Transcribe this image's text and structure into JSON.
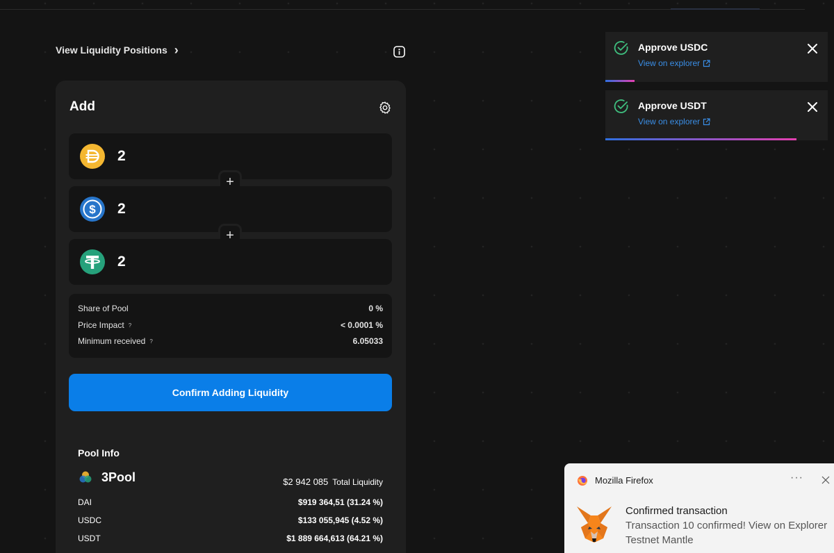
{
  "nav": {
    "positions_link": "View Liquidity Positions",
    "chevron": "›"
  },
  "card": {
    "title": "Add",
    "tokens": [
      {
        "symbol_icon": "dai-icon",
        "value": "2",
        "color": "#f4b731"
      },
      {
        "symbol_icon": "usdc-icon",
        "value": "2",
        "color": "#2775ca"
      },
      {
        "symbol_icon": "usdt-icon",
        "value": "2",
        "color": "#26a17b"
      }
    ],
    "plus": "+",
    "stats": [
      {
        "label": "Share of Pool",
        "help": "",
        "value": "0 %"
      },
      {
        "label": "Price Impact",
        "help": "?",
        "value": "< 0.0001 %"
      },
      {
        "label": "Minimum received",
        "help": "?",
        "value": "6.05033"
      }
    ],
    "confirm_label": "Confirm Adding Liquidity",
    "accent": "#0a7ee8"
  },
  "pool": {
    "title": "Pool Info",
    "name": "3Pool",
    "total_value": "$2 942 085",
    "total_label": "Total Liquidity",
    "rows": [
      {
        "label": "DAI",
        "value": "$919 364,51 (31.24 %)"
      },
      {
        "label": "USDC",
        "value": "$133 055,945 (4.52 %)"
      },
      {
        "label": "USDT",
        "value": "$1 889 664,613 (64.21 %)"
      }
    ]
  },
  "toasts": [
    {
      "title": "Approve USDC",
      "link": "View on explorer",
      "progress": 0.13
    },
    {
      "title": "Approve USDT",
      "link": "View on explorer",
      "progress": 0.86
    }
  ],
  "firefox": {
    "app": "Mozilla Firefox",
    "dots": "···",
    "title": "Confirmed transaction",
    "body": "Transaction 10 confirmed! View on Explorer",
    "network": "Testnet Mantle"
  }
}
